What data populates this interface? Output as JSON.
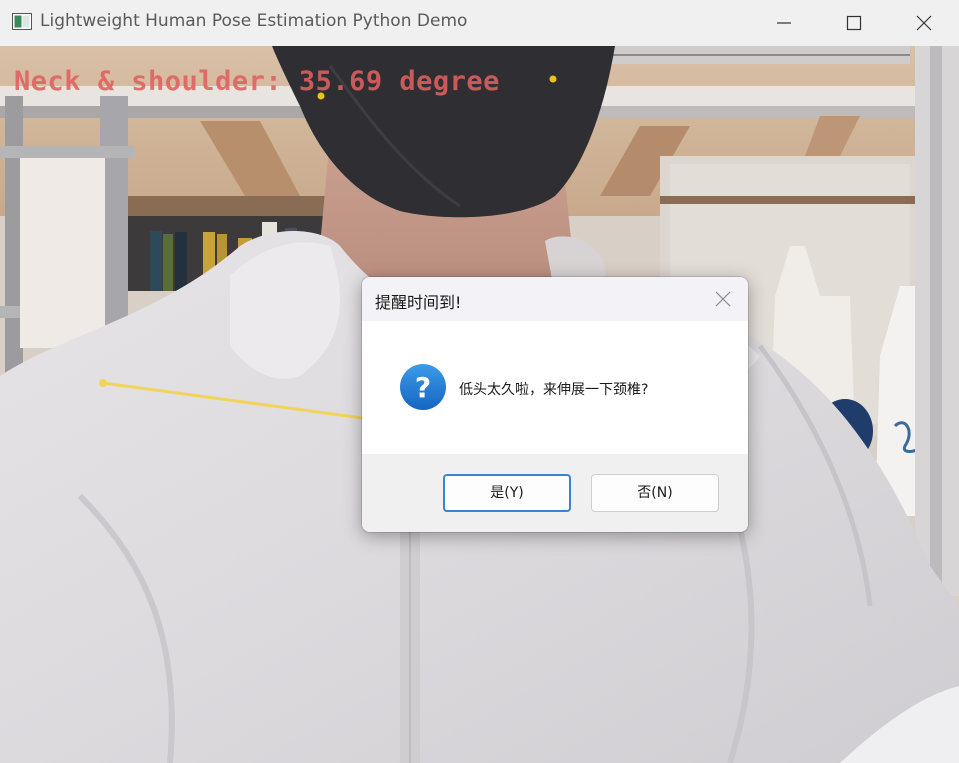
{
  "window": {
    "title": "Lightweight Human Pose Estimation Python Demo",
    "icon": "opencv-window-icon",
    "controls": [
      "minimize-icon",
      "maximize-icon",
      "close-icon"
    ]
  },
  "video": {
    "overlay_text": "Neck & shoulder: 35.69 degree",
    "overlay_color": "#e06060",
    "keypoint_color": "#e6c619",
    "skeleton_line_color": "#f2d45a"
  },
  "dialog": {
    "title": "提醒时间到!",
    "icon": "question-icon",
    "message": "低头太久啦，来伸展一下颈椎?",
    "yes_label": "是(Y)",
    "no_label": "否(N)",
    "accent_color": "#3b82d6"
  }
}
